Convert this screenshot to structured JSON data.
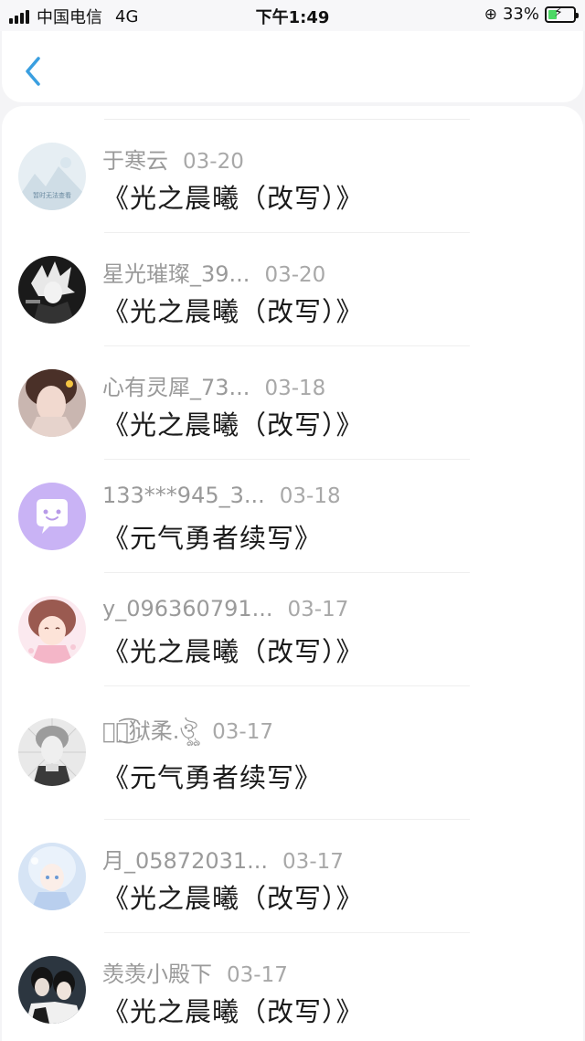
{
  "status_bar": {
    "carrier": "中国电信",
    "network": "4G",
    "time": "下午1:49",
    "battery": "33%",
    "battery_level": 0.33
  },
  "nav": {
    "back_icon": "chevron-left-icon",
    "accent_color": "#3a9fe0"
  },
  "items": [
    {
      "name": "于寒云",
      "date": "03-20",
      "title": "《光之晨曦（改写）》",
      "avatar_text": "暂时无法查看"
    },
    {
      "name": "星光璀璨_39...",
      "date": "03-20",
      "title": "《光之晨曦（改写）》"
    },
    {
      "name": "心有灵犀_73...",
      "date": "03-18",
      "title": "《光之晨曦（改写）》"
    },
    {
      "name": "133***945_3...",
      "date": "03-18",
      "title": "《元气勇者续写》"
    },
    {
      "name": "y_096360791...",
      "date": "03-17",
      "title": "《光之晨曦（改写）》"
    },
    {
      "name": "ঔৣ͜͡狱柔.ঔৣ",
      "date": "03-17",
      "title": "《元气勇者续写》"
    },
    {
      "name": "月_05872031...",
      "date": "03-17",
      "title": "《光之晨曦（改写）》"
    },
    {
      "name": "羡羡小殿下",
      "date": "03-17",
      "title": "《光之晨曦（改写）》"
    }
  ]
}
